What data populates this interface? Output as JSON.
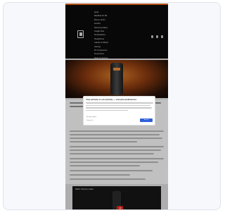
{
  "header": {
    "menu": [
      "Apple",
      "MacBook Air M3",
      "iPhone 16 Pro",
      "Android",
      "Samsung Galaxy",
      "Google Pixel",
      "Smartwatches",
      "Headphones",
      "Laptops & Tablets",
      "Gaming",
      "PC Components",
      "Smart Home",
      "Deals & Coupons",
      "How-to Guides",
      "Reviews",
      "Newsletter"
    ]
  },
  "consent": {
    "title": "Your privacy is our priority — consent preferences",
    "links": [
      "Manage options",
      "Vendor list"
    ],
    "accept_label": "Accept"
  },
  "video": {
    "title": "Watch: Hands-on video"
  }
}
